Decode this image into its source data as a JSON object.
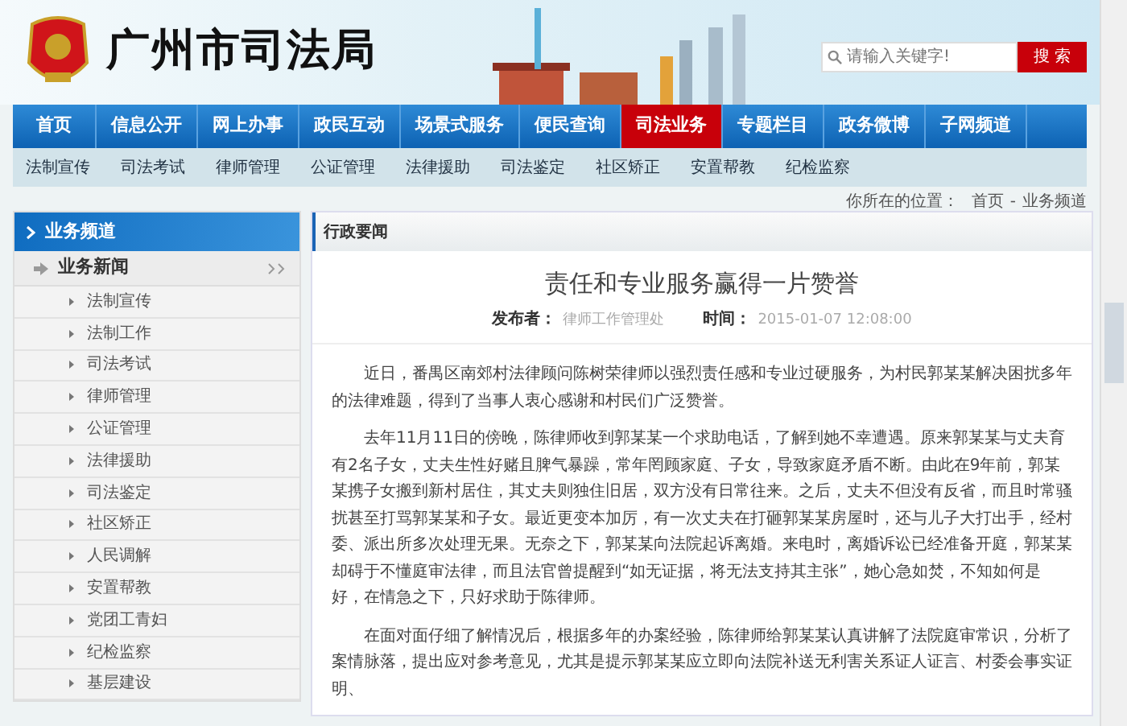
{
  "site": {
    "title": "广州市司法局",
    "search": {
      "placeholder": "请输入关键字!",
      "button": "搜 索"
    }
  },
  "main_nav": [
    {
      "label": "首页",
      "selected": false
    },
    {
      "label": "信息公开",
      "selected": false
    },
    {
      "label": "网上办事",
      "selected": false
    },
    {
      "label": "政民互动",
      "selected": false
    },
    {
      "label": "场景式服务",
      "selected": false
    },
    {
      "label": "便民查询",
      "selected": false
    },
    {
      "label": "司法业务",
      "selected": true
    },
    {
      "label": "专题栏目",
      "selected": false
    },
    {
      "label": "政务微博",
      "selected": false
    },
    {
      "label": "子网频道",
      "selected": false
    }
  ],
  "sub_nav": [
    "法制宣传",
    "司法考试",
    "律师管理",
    "公证管理",
    "法律援助",
    "司法鉴定",
    "社区矫正",
    "安置帮教",
    "纪检监察"
  ],
  "breadcrumb": {
    "label": "你所在的位置：",
    "items": [
      "首页",
      "业务频道"
    ],
    "separator": "-"
  },
  "sidebar": {
    "title": "业务频道",
    "items": [
      {
        "label": "业务新闻",
        "expanded": true,
        "children": [
          {
            "label": "法制宣传"
          },
          {
            "label": "法制工作"
          },
          {
            "label": "司法考试"
          },
          {
            "label": "律师管理"
          },
          {
            "label": "公证管理"
          },
          {
            "label": "法律援助"
          },
          {
            "label": "司法鉴定"
          },
          {
            "label": "社区矫正"
          },
          {
            "label": "人民调解"
          },
          {
            "label": "安置帮教"
          },
          {
            "label": "党团工青妇"
          },
          {
            "label": "纪检监察"
          },
          {
            "label": "基层建设"
          }
        ]
      }
    ]
  },
  "article": {
    "section": "行政要闻",
    "title": "责任和专业服务赢得一片赞誉",
    "publisher_label": "发布者：",
    "publisher": "律师工作管理处",
    "time_label": "时间：",
    "time": "2015-01-07 12:08:00",
    "paragraphs": [
      "近日，番禺区南郊村法律顾问陈树荣律师以强烈责任感和专业过硬服务，为村民郭某某解决困扰多年的法律难题，得到了当事人衷心感谢和村民们广泛赞誉。",
      "去年11月11日的傍晚，陈律师收到郭某某一个求助电话，了解到她不幸遭遇。原来郭某某与丈夫育有2名子女，丈夫生性好赌且脾气暴躁，常年罔顾家庭、子女，导致家庭矛盾不断。由此在9年前，郭某某携子女搬到新村居住，其丈夫则独住旧居，双方没有日常往来。之后，丈夫不但没有反省，而且时常骚扰甚至打骂郭某某和子女。最近更变本加厉，有一次丈夫在打砸郭某某房屋时，还与儿子大打出手，经村委、派出所多次处理无果。无奈之下，郭某某向法院起诉离婚。来电时，离婚诉讼已经准备开庭，郭某某却碍于不懂庭审法律，而且法官曾提醒到“如无证据，将无法支持其主张”，她心急如焚，不知如何是好，在情急之下，只好求助于陈律师。",
      "在面对面仔细了解情况后，根据多年的办案经验，陈律师给郭某某认真讲解了法院庭审常识，分析了案情脉落，提出应对参考意见，尤其是提示郭某某应立即向法院补送无利害关系证人证言、村委会事实证明、"
    ]
  }
}
